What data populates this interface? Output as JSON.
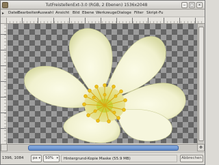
{
  "window": {
    "title": "TutFreistellenExt-3.0 (RGB, 2 Ebenen) 1536x2048"
  },
  "icons": {
    "app": "gimp-image-icon",
    "minimize": "minimize-icon",
    "maximize": "maximize-icon",
    "close": "close-icon",
    "menu_arrow": "menu-arrow-icon",
    "navigate": "navigate-icon"
  },
  "menubar": {
    "items": [
      "Datei",
      "Bearbeiten",
      "Auswahl",
      "Ansicht",
      "Bild",
      "Ebene",
      "Werkzeuge",
      "Dialoge",
      "Filter",
      "Skript-Fu"
    ]
  },
  "canvas": {
    "content": "white-flower-on-transparent-background"
  },
  "statusbar": {
    "coords": "1396, 1084",
    "unit": "px",
    "zoom": "50%",
    "message": "Hintergrund-Kopie Maske (55.9 MB)",
    "cancel": "Abbrechen"
  },
  "colors": {
    "petal": "#f3f3d6",
    "petal_shadow": "#c9cc93",
    "stamen": "#e8c21a",
    "center": "#c9d23c",
    "checker_dark": "#666666",
    "checker_light": "#9c9c9c",
    "scroll_thumb": "#5d86c6"
  }
}
